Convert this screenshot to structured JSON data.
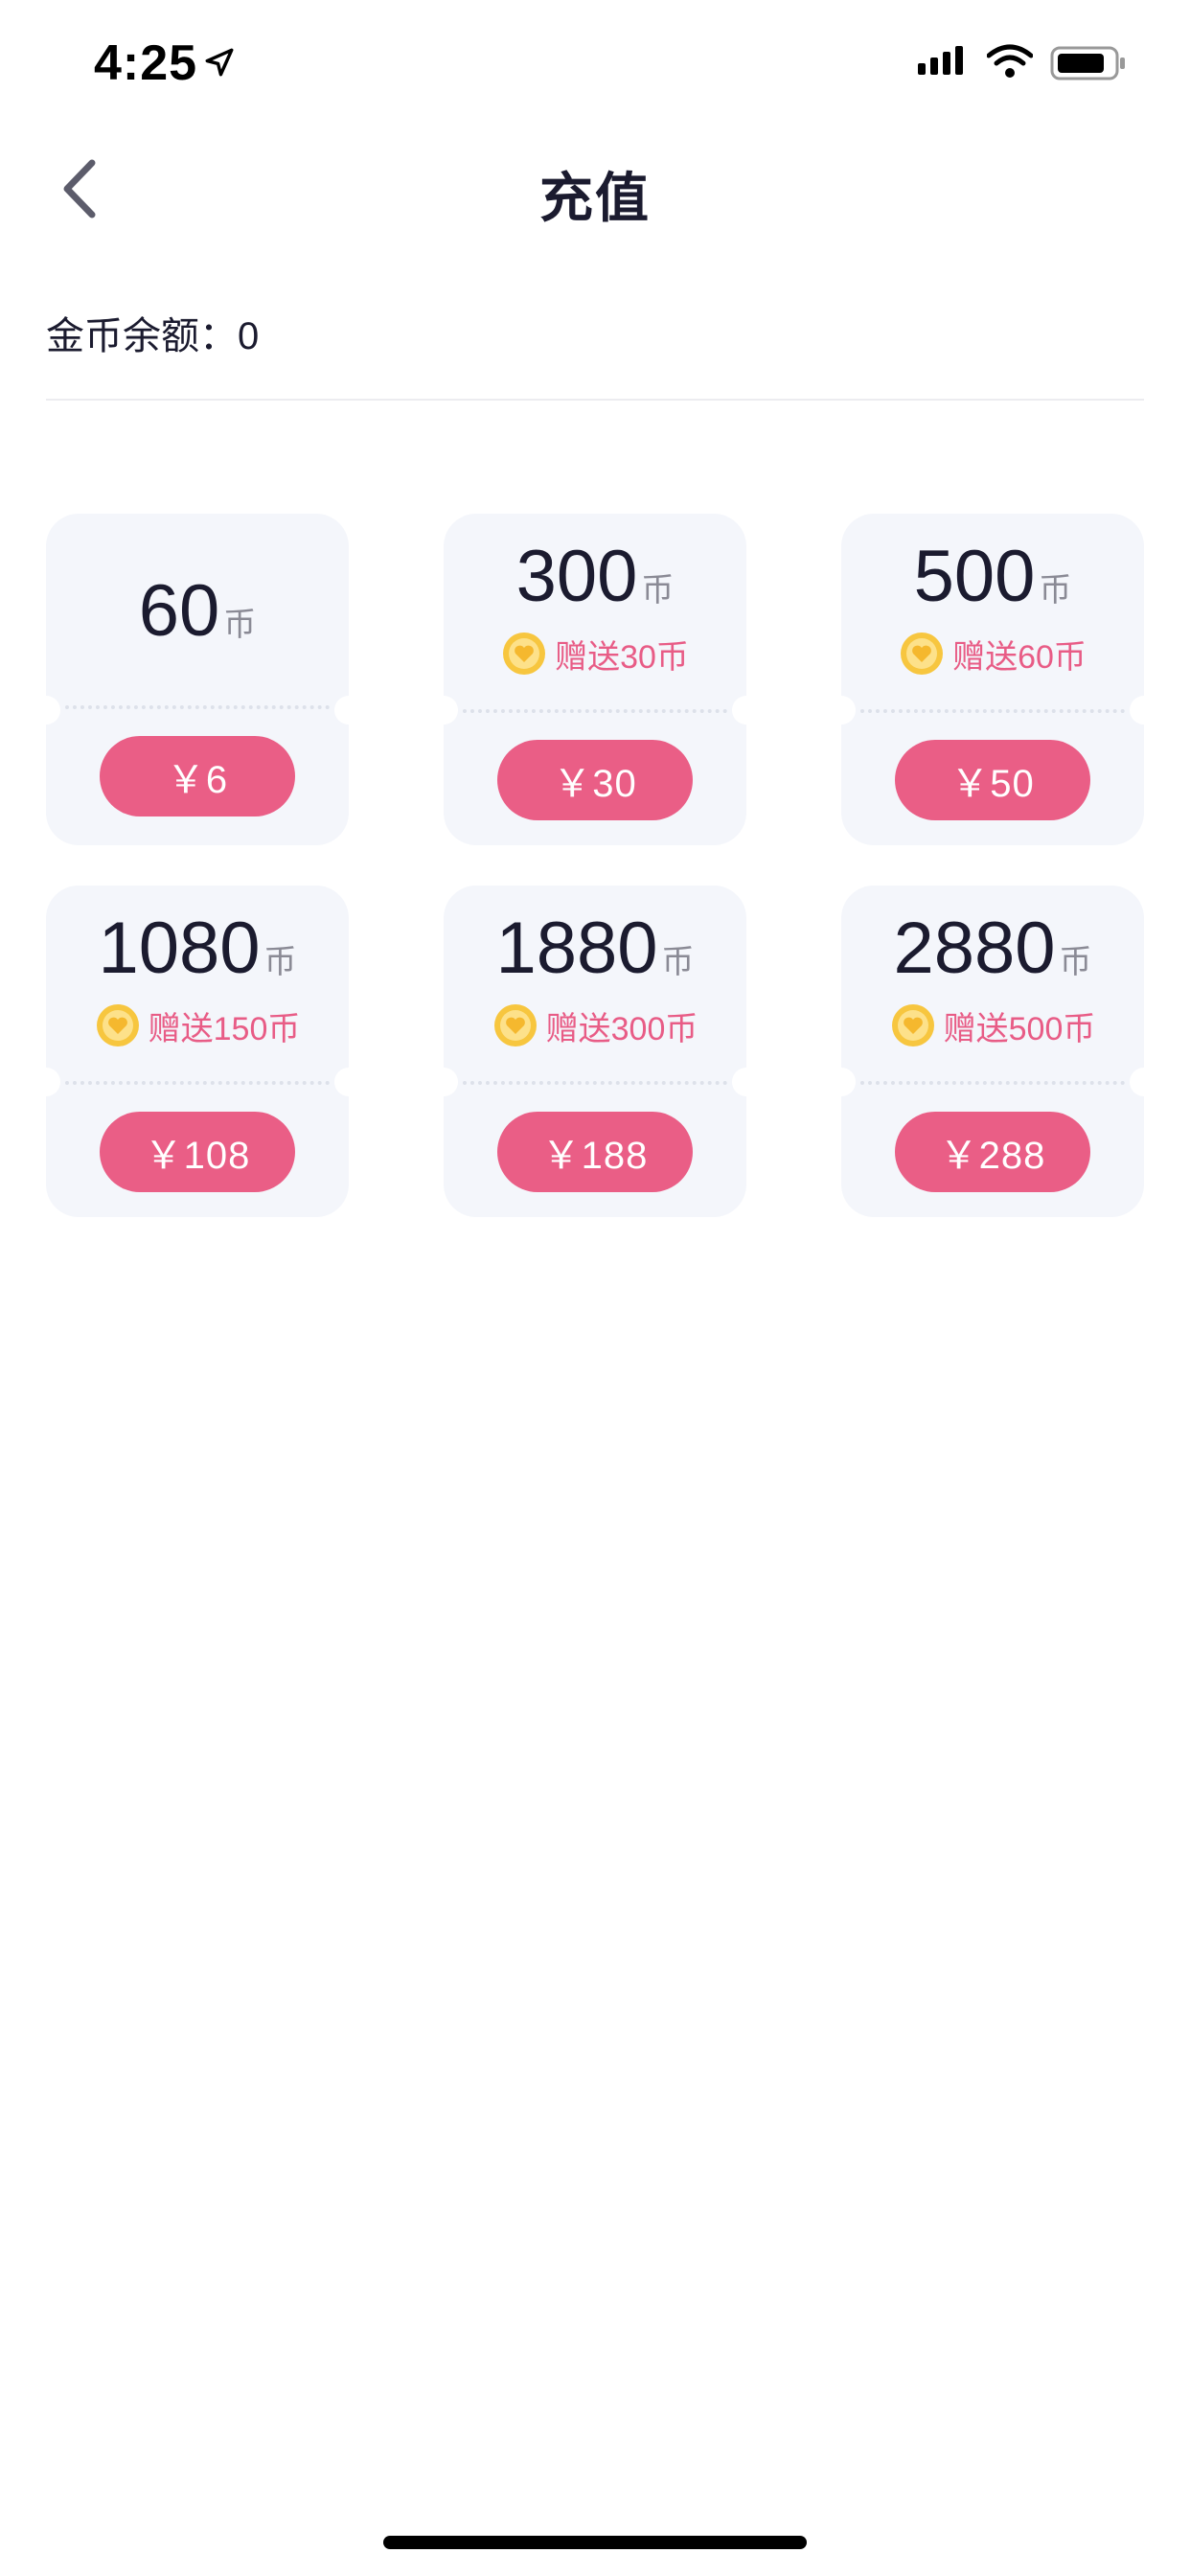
{
  "status_bar": {
    "time": "4:25",
    "icons": [
      "location-arrow-icon",
      "signal-icon",
      "wifi-icon",
      "battery-icon"
    ]
  },
  "nav": {
    "back_icon": "chevron-left-icon",
    "title": "充值"
  },
  "balance": {
    "text": "金币余额：0"
  },
  "coin_unit": "币",
  "packages": [
    {
      "coins": "60",
      "bonus": "",
      "price": "￥6"
    },
    {
      "coins": "300",
      "bonus": "赠送30币",
      "price": "￥30"
    },
    {
      "coins": "500",
      "bonus": "赠送60币",
      "price": "￥50"
    },
    {
      "coins": "1080",
      "bonus": "赠送150币",
      "price": "￥108"
    },
    {
      "coins": "1880",
      "bonus": "赠送300币",
      "price": "￥188"
    },
    {
      "coins": "2880",
      "bonus": "赠送500币",
      "price": "￥288"
    }
  ],
  "colors": {
    "accent": "#ea5e86",
    "card_bg": "#f4f6fb",
    "title_text": "#1b1b2f",
    "coin_gold": "#f7c63f"
  }
}
